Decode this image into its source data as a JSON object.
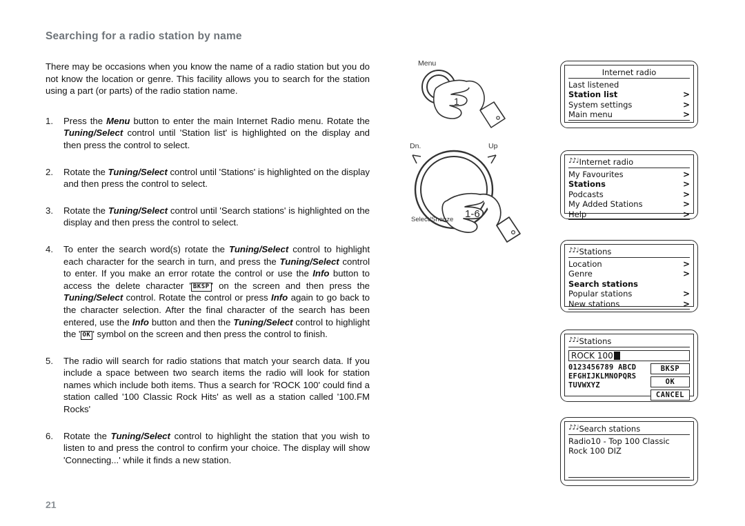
{
  "document": {
    "title": "Searching for a radio station by name",
    "page_number": "21",
    "intro": "There may be occasions when you know the name of a radio station but you do not know the location or genre. This facility allows you to search for the station using a part (or parts) of the radio station name."
  },
  "steps": [
    {
      "number": "1.",
      "parts": [
        {
          "t": "text",
          "v": "Press the "
        },
        {
          "t": "bold",
          "v": "Menu"
        },
        {
          "t": "text",
          "v": " button to enter the main Internet Radio menu. Rotate the "
        },
        {
          "t": "bold",
          "v": "Tuning/Select"
        },
        {
          "t": "text",
          "v": " control until 'Station list' is highlighted on the display and then press the control to select."
        }
      ]
    },
    {
      "number": "2.",
      "parts": [
        {
          "t": "text",
          "v": "Rotate the "
        },
        {
          "t": "bold",
          "v": "Tuning/Select"
        },
        {
          "t": "text",
          "v": " control until 'Stations' is highlighted on the display and then press the control to select."
        }
      ]
    },
    {
      "number": "3.",
      "parts": [
        {
          "t": "text",
          "v": "Rotate the "
        },
        {
          "t": "bold",
          "v": "Tuning/Select"
        },
        {
          "t": "text",
          "v": " control until 'Search stations' is highlighted on the display and then press the control to select."
        }
      ]
    },
    {
      "number": "4.",
      "parts": [
        {
          "t": "text",
          "v": "To enter the search word(s) rotate the "
        },
        {
          "t": "bold",
          "v": "Tuning/Select"
        },
        {
          "t": "text",
          "v": " control to highlight each character for the search in turn, and press the "
        },
        {
          "t": "bold",
          "v": "Tuning/Select"
        },
        {
          "t": "text",
          "v": " control to enter. If you make an error rotate the control or use the "
        },
        {
          "t": "bold",
          "v": "Info"
        },
        {
          "t": "text",
          "v": " button to access the delete character '"
        },
        {
          "t": "key",
          "v": "BKSP"
        },
        {
          "t": "text",
          "v": "' on the screen and then press the "
        },
        {
          "t": "bold",
          "v": "Tuning/Select"
        },
        {
          "t": "text",
          "v": " control. Rotate the control or press "
        },
        {
          "t": "bold",
          "v": "Info"
        },
        {
          "t": "text",
          "v": " again to go back to the character selection. After the final character of the search has been entered, use the "
        },
        {
          "t": "bold",
          "v": "Info"
        },
        {
          "t": "text",
          "v": " button and then the "
        },
        {
          "t": "bold",
          "v": "Tuning/Select"
        },
        {
          "t": "text",
          "v": " control to highlight the '"
        },
        {
          "t": "key",
          "v": "OK"
        },
        {
          "t": "text",
          "v": "' symbol on the screen and then press the control to finish."
        }
      ]
    },
    {
      "number": "5.",
      "parts": [
        {
          "t": "text",
          "v": "The radio will search for radio stations that match your search data. If you include a space between two search items the radio will look for station names which include both items. Thus a search for 'ROCK 100' could find a station called '100 Classic Rock Hits' as well as a station called '100.FM Rocks'"
        }
      ]
    },
    {
      "number": "6.",
      "parts": [
        {
          "t": "text",
          "v": "Rotate the "
        },
        {
          "t": "bold",
          "v": "Tuning/Select"
        },
        {
          "t": "text",
          "v": " control to highlight the station that you wish to listen to and press the control to confirm your choice. The display will show 'Connecting...' while it finds a new station."
        }
      ]
    }
  ],
  "illustrations": {
    "menu_button": {
      "label": "Menu",
      "step_ref": "1",
      "icon": "hand-pressing-button-icon"
    },
    "tuning_knob": {
      "label_down": "Dn.",
      "label_up": "Up",
      "label_select": "Select/Snooze",
      "step_ref": "1-6",
      "icon": "hand-rotating-knob-icon"
    }
  },
  "lcd_screens": [
    {
      "name": "internet-radio-menu",
      "header": "Internet radio",
      "header_icon": "",
      "header_centered": true,
      "rows": [
        {
          "label": "Last listened",
          "arrow": "",
          "selected": false
        },
        {
          "label": "Station list",
          "arrow": ">",
          "selected": true
        },
        {
          "label": "System settings",
          "arrow": ">",
          "selected": false
        },
        {
          "label": "Main menu",
          "arrow": ">",
          "selected": false
        }
      ]
    },
    {
      "name": "station-list-menu",
      "header": "Internet radio",
      "header_icon": "♪♪♩",
      "header_centered": false,
      "rows": [
        {
          "label": "My Favourites",
          "arrow": ">",
          "selected": false
        },
        {
          "label": "Stations",
          "arrow": ">",
          "selected": true
        },
        {
          "label": "Podcasts",
          "arrow": ">",
          "selected": false
        },
        {
          "label": "My Added Stations",
          "arrow": ">",
          "selected": false
        },
        {
          "label": "Help",
          "arrow": ">",
          "selected": false
        }
      ]
    },
    {
      "name": "stations-menu",
      "header": "Stations",
      "header_icon": "♪♪♩",
      "header_centered": false,
      "rows": [
        {
          "label": "Location",
          "arrow": ">",
          "selected": false
        },
        {
          "label": "Genre",
          "arrow": ">",
          "selected": false
        },
        {
          "label": "Search stations",
          "arrow": "",
          "selected": true
        },
        {
          "label": "Popular stations",
          "arrow": ">",
          "selected": false
        },
        {
          "label": "New stations",
          "arrow": ">",
          "selected": false
        }
      ]
    },
    {
      "name": "search-keyboard",
      "header": "Stations",
      "header_icon": "♪♪♩",
      "header_centered": false,
      "input_value": "ROCK 100",
      "char_rows": [
        "0123456789 ABCD",
        "EFGHIJKLMNOPQRS",
        "TUVWXYZ"
      ],
      "buttons": [
        "BKSP",
        "OK",
        "CANCEL"
      ]
    },
    {
      "name": "search-results",
      "header": "Search stations",
      "header_icon": "♪♪♩",
      "header_centered": false,
      "result_lines": [
        "Radio10 - Top 100 Classic",
        "Rock 100 DIZ"
      ]
    }
  ]
}
